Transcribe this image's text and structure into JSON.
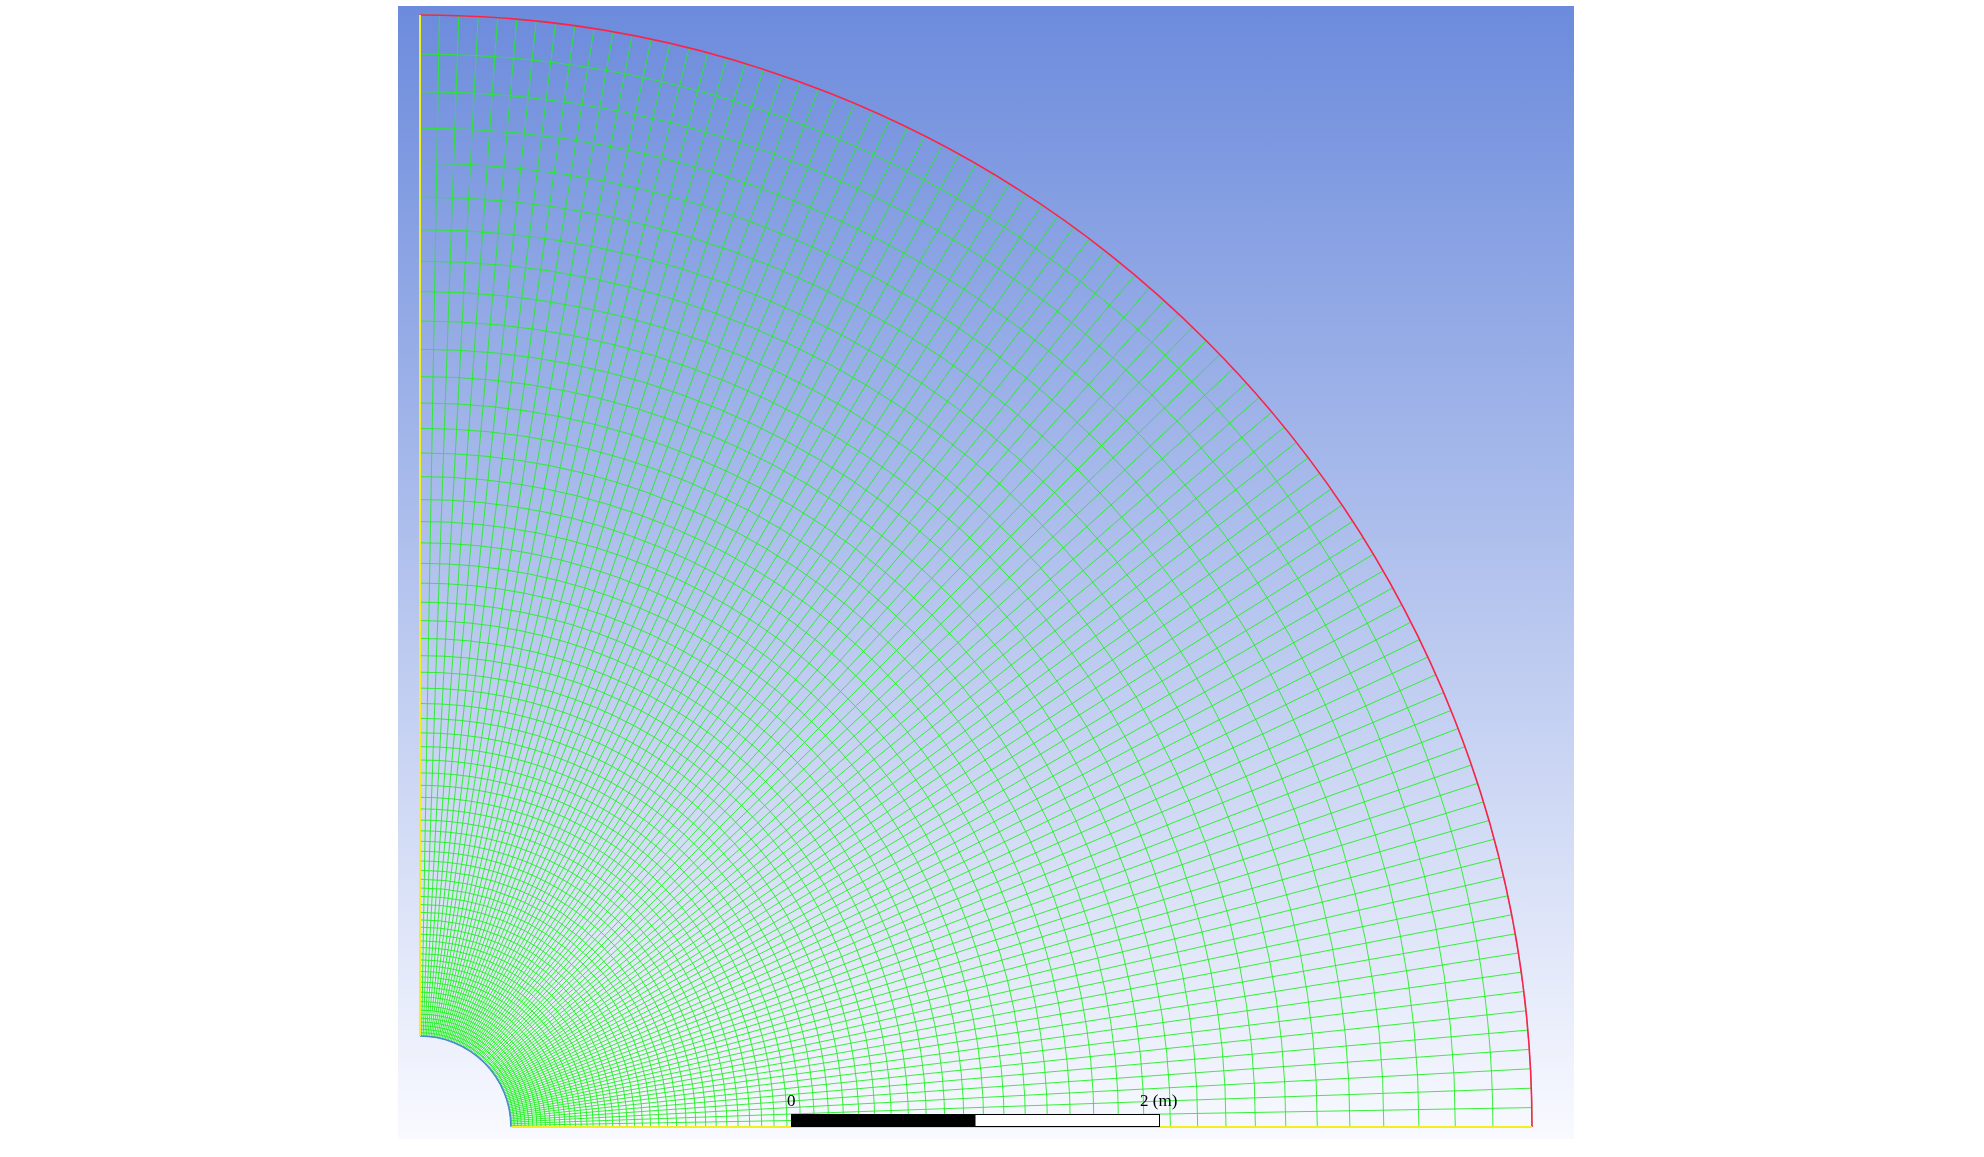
{
  "scale_bar": {
    "start_label": "0",
    "end_label": "2 (m)"
  }
}
